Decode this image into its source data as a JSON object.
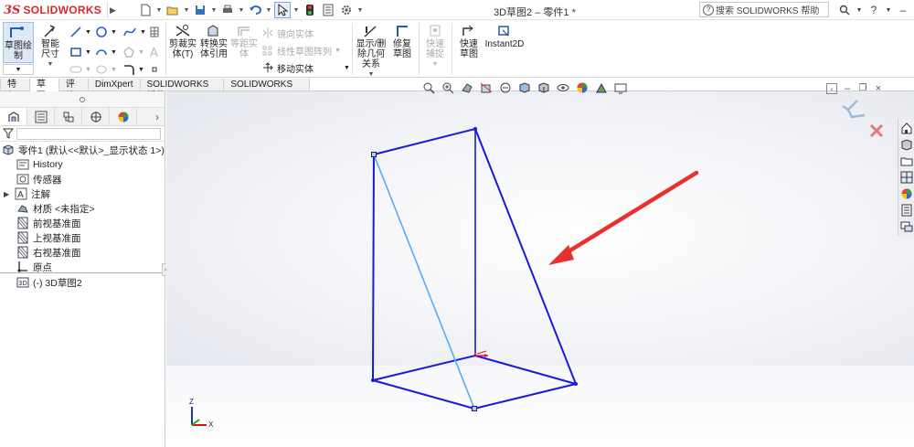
{
  "app": {
    "logo_ds": "3S",
    "logo_text": "SOLIDWORKS"
  },
  "window": {
    "doc_title": "3D草图2 – 零件1 *"
  },
  "search": {
    "label": "搜索 SOLIDWORKS 帮助"
  },
  "window_controls": {
    "help": "?",
    "minimize": "–",
    "maximize": "□",
    "close": "×"
  },
  "ribbon": {
    "sketch_label": "草图绘制",
    "smart_dim_label": "智能尺寸",
    "trim_label": "剪裁实体(T)",
    "convert_label": "转换实体引用",
    "offset_label": "等距实体",
    "mirror_label": "镜向实体",
    "linear_pattern_label": "线性草图阵列",
    "move_label": "移动实体",
    "display_relations_label": "显示/删除几何关系",
    "repair_label": "修复草图",
    "quick_snap_label": "快速捕捉",
    "rapid_sketch_label": "快速草图",
    "instant2d_label": "Instant2D"
  },
  "tabs": [
    {
      "label": "特征"
    },
    {
      "label": "草图"
    },
    {
      "label": "评估"
    },
    {
      "label": "DimXpert"
    },
    {
      "label": "SOLIDWORKS 插件"
    },
    {
      "label": "SOLIDWORKS MBD"
    }
  ],
  "tree": {
    "root": "零件1 (默认<<默认>_显示状态 1>)",
    "items": [
      {
        "label": "History",
        "icon": "history-folder-icon"
      },
      {
        "label": "传感器",
        "icon": "sensor-icon"
      },
      {
        "label": "注解",
        "icon": "annotation-icon"
      },
      {
        "label": "材质 <未指定>",
        "icon": "material-icon"
      },
      {
        "label": "前视基准面",
        "icon": "plane-icon"
      },
      {
        "label": "上视基准面",
        "icon": "plane-icon"
      },
      {
        "label": "右视基准面",
        "icon": "plane-icon"
      },
      {
        "label": "原点",
        "icon": "origin-icon"
      },
      {
        "label": "(-) 3D草图2",
        "icon": "3d-sketch-icon"
      }
    ]
  },
  "triad": {
    "z": "Z",
    "x": "X"
  },
  "colors": {
    "sketch_blue": "#1a1adb",
    "construction_blue": "#5aaaf0",
    "annotation_red": "#e8312f",
    "brand_red": "#d9272e"
  }
}
